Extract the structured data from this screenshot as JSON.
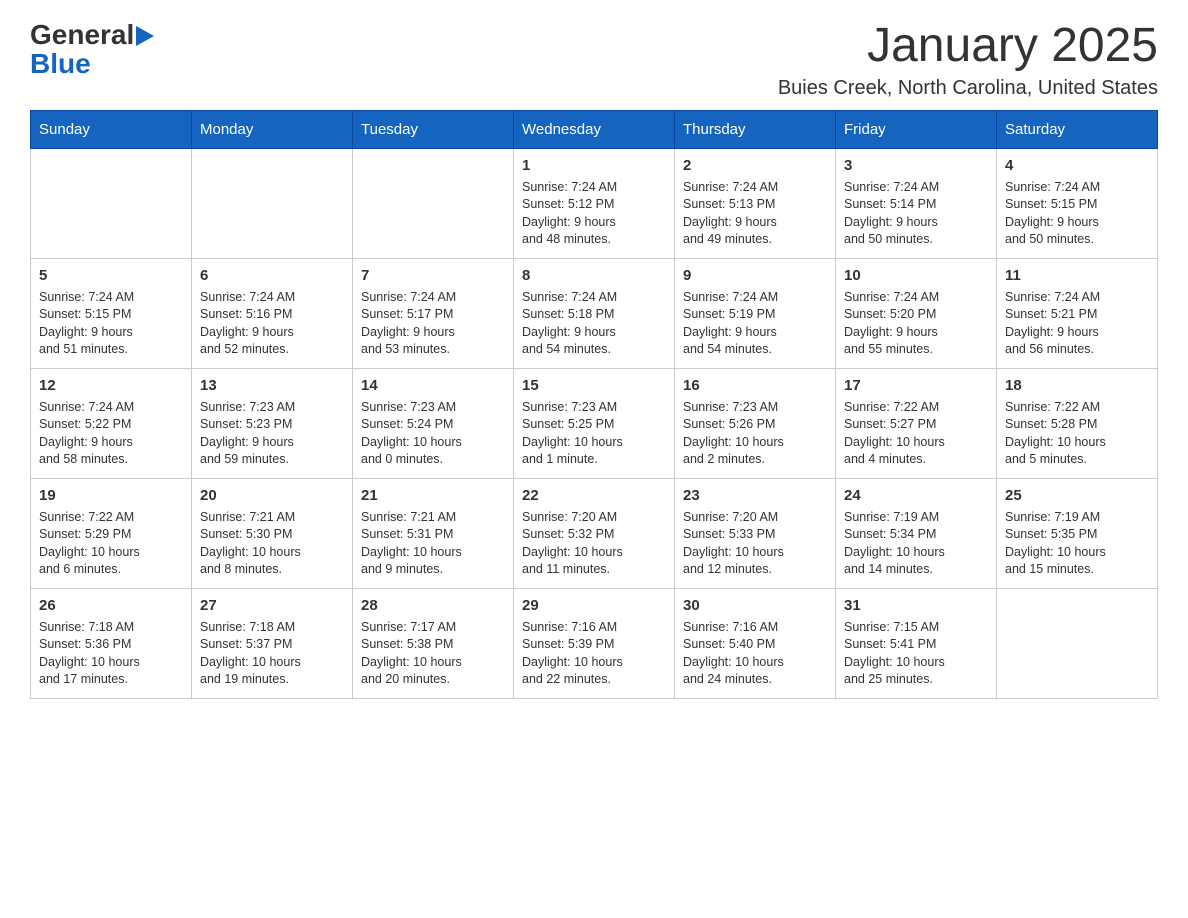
{
  "logo": {
    "text_general": "General",
    "text_blue": "Blue",
    "triangle": "▶"
  },
  "header": {
    "title": "January 2025",
    "subtitle": "Buies Creek, North Carolina, United States"
  },
  "weekdays": [
    "Sunday",
    "Monday",
    "Tuesday",
    "Wednesday",
    "Thursday",
    "Friday",
    "Saturday"
  ],
  "weeks": [
    [
      {
        "day": "",
        "info": ""
      },
      {
        "day": "",
        "info": ""
      },
      {
        "day": "",
        "info": ""
      },
      {
        "day": "1",
        "info": "Sunrise: 7:24 AM\nSunset: 5:12 PM\nDaylight: 9 hours\nand 48 minutes."
      },
      {
        "day": "2",
        "info": "Sunrise: 7:24 AM\nSunset: 5:13 PM\nDaylight: 9 hours\nand 49 minutes."
      },
      {
        "day": "3",
        "info": "Sunrise: 7:24 AM\nSunset: 5:14 PM\nDaylight: 9 hours\nand 50 minutes."
      },
      {
        "day": "4",
        "info": "Sunrise: 7:24 AM\nSunset: 5:15 PM\nDaylight: 9 hours\nand 50 minutes."
      }
    ],
    [
      {
        "day": "5",
        "info": "Sunrise: 7:24 AM\nSunset: 5:15 PM\nDaylight: 9 hours\nand 51 minutes."
      },
      {
        "day": "6",
        "info": "Sunrise: 7:24 AM\nSunset: 5:16 PM\nDaylight: 9 hours\nand 52 minutes."
      },
      {
        "day": "7",
        "info": "Sunrise: 7:24 AM\nSunset: 5:17 PM\nDaylight: 9 hours\nand 53 minutes."
      },
      {
        "day": "8",
        "info": "Sunrise: 7:24 AM\nSunset: 5:18 PM\nDaylight: 9 hours\nand 54 minutes."
      },
      {
        "day": "9",
        "info": "Sunrise: 7:24 AM\nSunset: 5:19 PM\nDaylight: 9 hours\nand 54 minutes."
      },
      {
        "day": "10",
        "info": "Sunrise: 7:24 AM\nSunset: 5:20 PM\nDaylight: 9 hours\nand 55 minutes."
      },
      {
        "day": "11",
        "info": "Sunrise: 7:24 AM\nSunset: 5:21 PM\nDaylight: 9 hours\nand 56 minutes."
      }
    ],
    [
      {
        "day": "12",
        "info": "Sunrise: 7:24 AM\nSunset: 5:22 PM\nDaylight: 9 hours\nand 58 minutes."
      },
      {
        "day": "13",
        "info": "Sunrise: 7:23 AM\nSunset: 5:23 PM\nDaylight: 9 hours\nand 59 minutes."
      },
      {
        "day": "14",
        "info": "Sunrise: 7:23 AM\nSunset: 5:24 PM\nDaylight: 10 hours\nand 0 minutes."
      },
      {
        "day": "15",
        "info": "Sunrise: 7:23 AM\nSunset: 5:25 PM\nDaylight: 10 hours\nand 1 minute."
      },
      {
        "day": "16",
        "info": "Sunrise: 7:23 AM\nSunset: 5:26 PM\nDaylight: 10 hours\nand 2 minutes."
      },
      {
        "day": "17",
        "info": "Sunrise: 7:22 AM\nSunset: 5:27 PM\nDaylight: 10 hours\nand 4 minutes."
      },
      {
        "day": "18",
        "info": "Sunrise: 7:22 AM\nSunset: 5:28 PM\nDaylight: 10 hours\nand 5 minutes."
      }
    ],
    [
      {
        "day": "19",
        "info": "Sunrise: 7:22 AM\nSunset: 5:29 PM\nDaylight: 10 hours\nand 6 minutes."
      },
      {
        "day": "20",
        "info": "Sunrise: 7:21 AM\nSunset: 5:30 PM\nDaylight: 10 hours\nand 8 minutes."
      },
      {
        "day": "21",
        "info": "Sunrise: 7:21 AM\nSunset: 5:31 PM\nDaylight: 10 hours\nand 9 minutes."
      },
      {
        "day": "22",
        "info": "Sunrise: 7:20 AM\nSunset: 5:32 PM\nDaylight: 10 hours\nand 11 minutes."
      },
      {
        "day": "23",
        "info": "Sunrise: 7:20 AM\nSunset: 5:33 PM\nDaylight: 10 hours\nand 12 minutes."
      },
      {
        "day": "24",
        "info": "Sunrise: 7:19 AM\nSunset: 5:34 PM\nDaylight: 10 hours\nand 14 minutes."
      },
      {
        "day": "25",
        "info": "Sunrise: 7:19 AM\nSunset: 5:35 PM\nDaylight: 10 hours\nand 15 minutes."
      }
    ],
    [
      {
        "day": "26",
        "info": "Sunrise: 7:18 AM\nSunset: 5:36 PM\nDaylight: 10 hours\nand 17 minutes."
      },
      {
        "day": "27",
        "info": "Sunrise: 7:18 AM\nSunset: 5:37 PM\nDaylight: 10 hours\nand 19 minutes."
      },
      {
        "day": "28",
        "info": "Sunrise: 7:17 AM\nSunset: 5:38 PM\nDaylight: 10 hours\nand 20 minutes."
      },
      {
        "day": "29",
        "info": "Sunrise: 7:16 AM\nSunset: 5:39 PM\nDaylight: 10 hours\nand 22 minutes."
      },
      {
        "day": "30",
        "info": "Sunrise: 7:16 AM\nSunset: 5:40 PM\nDaylight: 10 hours\nand 24 minutes."
      },
      {
        "day": "31",
        "info": "Sunrise: 7:15 AM\nSunset: 5:41 PM\nDaylight: 10 hours\nand 25 minutes."
      },
      {
        "day": "",
        "info": ""
      }
    ]
  ]
}
